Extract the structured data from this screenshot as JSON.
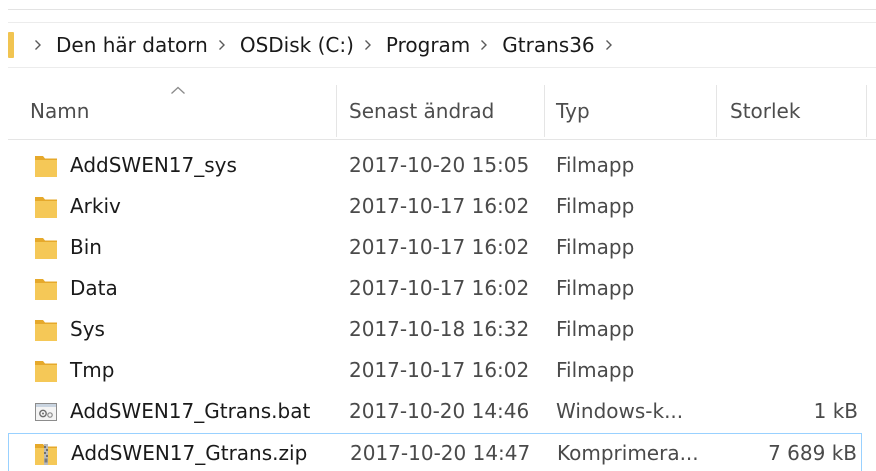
{
  "breadcrumb": {
    "segments": [
      "Den här datorn",
      "OSDisk (C:)",
      "Program",
      "Gtrans36"
    ]
  },
  "columns": {
    "name": "Namn",
    "modified": "Senast ändrad",
    "type": "Typ",
    "size": "Storlek"
  },
  "files": [
    {
      "name": "AddSWEN17_sys",
      "modified": "2017-10-20 15:05",
      "type": "Filmapp",
      "size": "",
      "icon": "folder-icon"
    },
    {
      "name": "Arkiv",
      "modified": "2017-10-17 16:02",
      "type": "Filmapp",
      "size": "",
      "icon": "folder-icon"
    },
    {
      "name": "Bin",
      "modified": "2017-10-17 16:02",
      "type": "Filmapp",
      "size": "",
      "icon": "folder-icon"
    },
    {
      "name": "Data",
      "modified": "2017-10-17 16:02",
      "type": "Filmapp",
      "size": "",
      "icon": "folder-icon"
    },
    {
      "name": "Sys",
      "modified": "2017-10-18 16:32",
      "type": "Filmapp",
      "size": "",
      "icon": "folder-icon"
    },
    {
      "name": "Tmp",
      "modified": "2017-10-17 16:02",
      "type": "Filmapp",
      "size": "",
      "icon": "folder-icon"
    },
    {
      "name": "AddSWEN17_Gtrans.bat",
      "modified": "2017-10-20 14:46",
      "type": "Windows-k...",
      "size": "1 kB",
      "icon": "batch-file-icon"
    },
    {
      "name": "AddSWEN17_Gtrans.zip",
      "modified": "2017-10-20 14:47",
      "type": "Komprimera...",
      "size": "7 689 kB",
      "icon": "zip-file-icon"
    }
  ],
  "colors": {
    "folder": "#f1c451",
    "selection_border": "#99d1ff"
  }
}
